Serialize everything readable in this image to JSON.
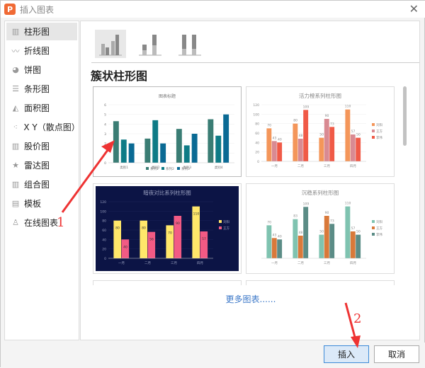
{
  "window": {
    "title": "插入图表",
    "logo": "P",
    "close": "✕"
  },
  "sidebar": {
    "items": [
      {
        "label": "柱形图",
        "icon": "column-chart-icon",
        "glyph": "▥"
      },
      {
        "label": "折线图",
        "icon": "line-chart-icon",
        "glyph": "〰"
      },
      {
        "label": "饼图",
        "icon": "pie-chart-icon",
        "glyph": "◕"
      },
      {
        "label": "条形图",
        "icon": "bar-chart-icon",
        "glyph": "☰"
      },
      {
        "label": "面积图",
        "icon": "area-chart-icon",
        "glyph": "◭"
      },
      {
        "label": "X Y（散点图）",
        "icon": "scatter-chart-icon",
        "glyph": "⁖"
      },
      {
        "label": "股价图",
        "icon": "stock-chart-icon",
        "glyph": "▥"
      },
      {
        "label": "雷达图",
        "icon": "radar-chart-icon",
        "glyph": "★"
      },
      {
        "label": "组合图",
        "icon": "combo-chart-icon",
        "glyph": "▥"
      },
      {
        "label": "模板",
        "icon": "template-icon",
        "glyph": "▤"
      },
      {
        "label": "在线图表",
        "icon": "online-chart-icon",
        "glyph": "♙"
      }
    ]
  },
  "main": {
    "heading": "簇状柱形图",
    "more_link": "更多图表......"
  },
  "buttons": {
    "insert": "插入",
    "cancel": "取消"
  },
  "annotations": {
    "one": "1",
    "two": "2"
  },
  "chart_data": [
    {
      "type": "bar",
      "title": "图表标题",
      "categories": [
        "类别1",
        "类别2",
        "类别3",
        "类别4"
      ],
      "ylim": [
        0,
        6
      ],
      "yticks": [
        0,
        1,
        2,
        3,
        4,
        5,
        6
      ],
      "show_labels": false,
      "legend": "bottom",
      "bg": "#ffffff",
      "text": "#777777",
      "series": [
        {
          "name": "系列1",
          "color": "#3a7d74",
          "values": [
            4.3,
            2.5,
            3.5,
            4.5
          ]
        },
        {
          "name": "系列2",
          "color": "#0e7b86",
          "values": [
            2.4,
            4.4,
            1.8,
            2.8
          ]
        },
        {
          "name": "系列3",
          "color": "#0a6a94",
          "values": [
            2,
            2,
            3,
            5
          ]
        }
      ]
    },
    {
      "type": "bar",
      "title": "活力橙系列柱形图",
      "categories": [
        "一月",
        "二月",
        "三月",
        "四月"
      ],
      "ylim": [
        0,
        120
      ],
      "yticks": [
        0,
        20,
        40,
        60,
        80,
        100,
        120
      ],
      "show_labels": true,
      "legend": "right",
      "bg": "#ffffff",
      "text": "#888888",
      "series": [
        {
          "name": "刘阳",
          "color": "#f4965a",
          "values": [
            70,
            80,
            50,
            110
          ]
        },
        {
          "name": "王方",
          "color": "#d98a92",
          "values": [
            43,
            48,
            90,
            57
          ]
        },
        {
          "name": "李伟",
          "color": "#f05a47",
          "values": [
            40,
            109,
            73,
            50
          ]
        }
      ]
    },
    {
      "type": "bar",
      "title": "暗夜对比系列柱形图",
      "categories": [
        "一月",
        "二月",
        "三月",
        "四月"
      ],
      "ylim": [
        0,
        120
      ],
      "yticks": [
        0,
        20,
        40,
        60,
        80,
        100,
        120
      ],
      "show_labels": true,
      "legend": "right",
      "bg": "#0c1445",
      "text": "#9aa0c0",
      "series": [
        {
          "name": "刘阳",
          "color": "#ffe76a",
          "values": [
            80,
            80,
            70,
            110
          ]
        },
        {
          "name": "王方",
          "color": "#f25a84",
          "values": [
            40,
            56,
            90,
            57
          ]
        }
      ]
    },
    {
      "type": "bar",
      "title": "沉稳系列柱形图",
      "categories": [
        "一月",
        "二月",
        "三月",
        "四月"
      ],
      "ylim": [
        0,
        120
      ],
      "yticks": [],
      "show_labels": true,
      "legend": "right",
      "bg": "#ffffff",
      "text": "#888888",
      "series": [
        {
          "name": "刘阳",
          "color": "#7fc3b0",
          "values": [
            70,
            83,
            50,
            110
          ]
        },
        {
          "name": "王方",
          "color": "#d9793a",
          "values": [
            43,
            48,
            90,
            57
          ]
        },
        {
          "name": "李伟",
          "color": "#5b8c86",
          "values": [
            40,
            109,
            73,
            50
          ]
        }
      ]
    }
  ]
}
